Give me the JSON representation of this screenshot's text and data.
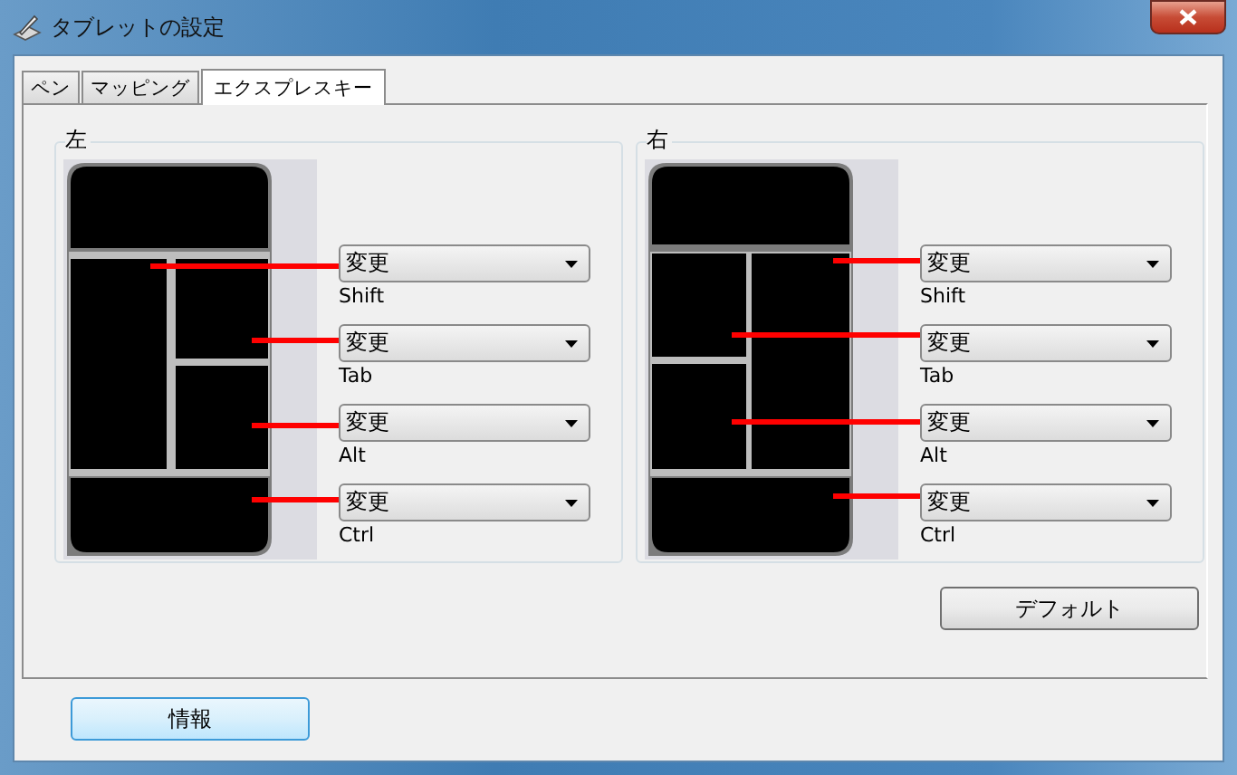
{
  "window": {
    "title": "タブレットの設定"
  },
  "tabs": [
    {
      "label": "ペン",
      "selected": false
    },
    {
      "label": "マッピング",
      "selected": false
    },
    {
      "label": "エクスプレスキー",
      "selected": true
    }
  ],
  "groups": [
    {
      "label": "左",
      "kind": "left",
      "keys": [
        {
          "value": "変更",
          "label": "Shift"
        },
        {
          "value": "変更",
          "label": "Tab"
        },
        {
          "value": "変更",
          "label": "Alt"
        },
        {
          "value": "変更",
          "label": "Ctrl"
        }
      ]
    },
    {
      "label": "右",
      "kind": "right",
      "keys": [
        {
          "value": "変更",
          "label": "Shift"
        },
        {
          "value": "変更",
          "label": "Tab"
        },
        {
          "value": "変更",
          "label": "Alt"
        },
        {
          "value": "変更",
          "label": "Ctrl"
        }
      ]
    }
  ],
  "default_button": "デフォルト",
  "info_button": "情報"
}
